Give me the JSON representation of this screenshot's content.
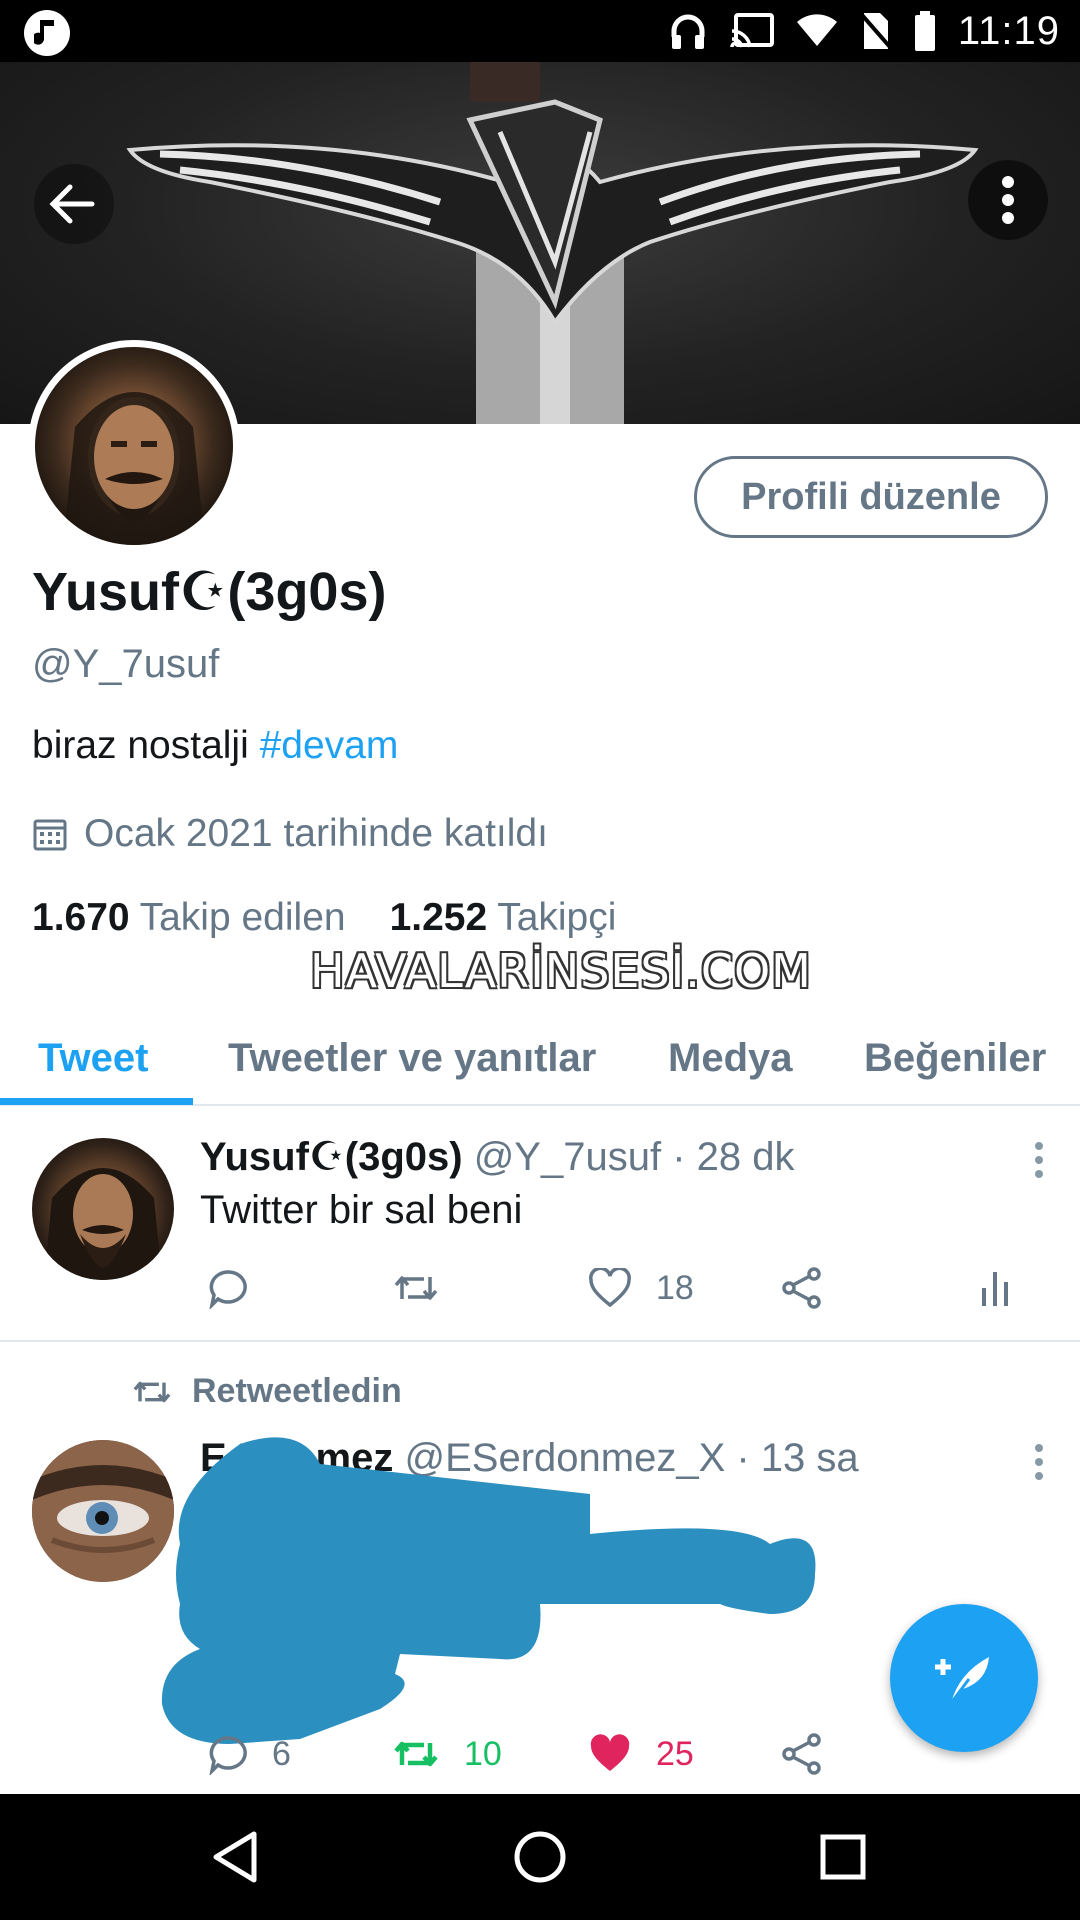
{
  "status_bar": {
    "time": "11:19",
    "icons": [
      "music-app-icon",
      "headphones-icon",
      "cast-icon",
      "wifi-icon",
      "no-sim-icon",
      "battery-icon"
    ]
  },
  "profile": {
    "display_name": "Yusuf☪(3g0s)",
    "handle": "@Y_7usuf",
    "bio_text": "biraz nostalji ",
    "bio_hashtag": "#devam",
    "joined": "Ocak 2021 tarihinde katıldı",
    "following_count": "1.670",
    "following_label": "Takip edilen",
    "followers_count": "1.252",
    "followers_label": "Takipçi",
    "edit_button": "Profili düzenle"
  },
  "watermark": "HAVALARİNSESİ.COM",
  "tabs": [
    {
      "label": "Tweet",
      "active": true
    },
    {
      "label": "Tweetler ve yanıtlar",
      "active": false
    },
    {
      "label": "Medya",
      "active": false
    },
    {
      "label": "Beğeniler",
      "active": false
    }
  ],
  "tweets": [
    {
      "name": "Yusuf☪(3g0s)",
      "handle": "@Y_7usuf",
      "time": "· 28 dk",
      "text": "Twitter bir sal beni",
      "likes": "18"
    },
    {
      "retweet_label": "Retweetledin",
      "name": "E Dönmez",
      "handle": "@ESerdonmez_X",
      "time": "· 13 sa",
      "replies": "6",
      "retweets": "10",
      "likes": "25"
    }
  ],
  "colors": {
    "accent": "#1da1f2",
    "secondary_text": "#657786",
    "retweet_green": "#17bf63",
    "like_red": "#e0245e"
  }
}
